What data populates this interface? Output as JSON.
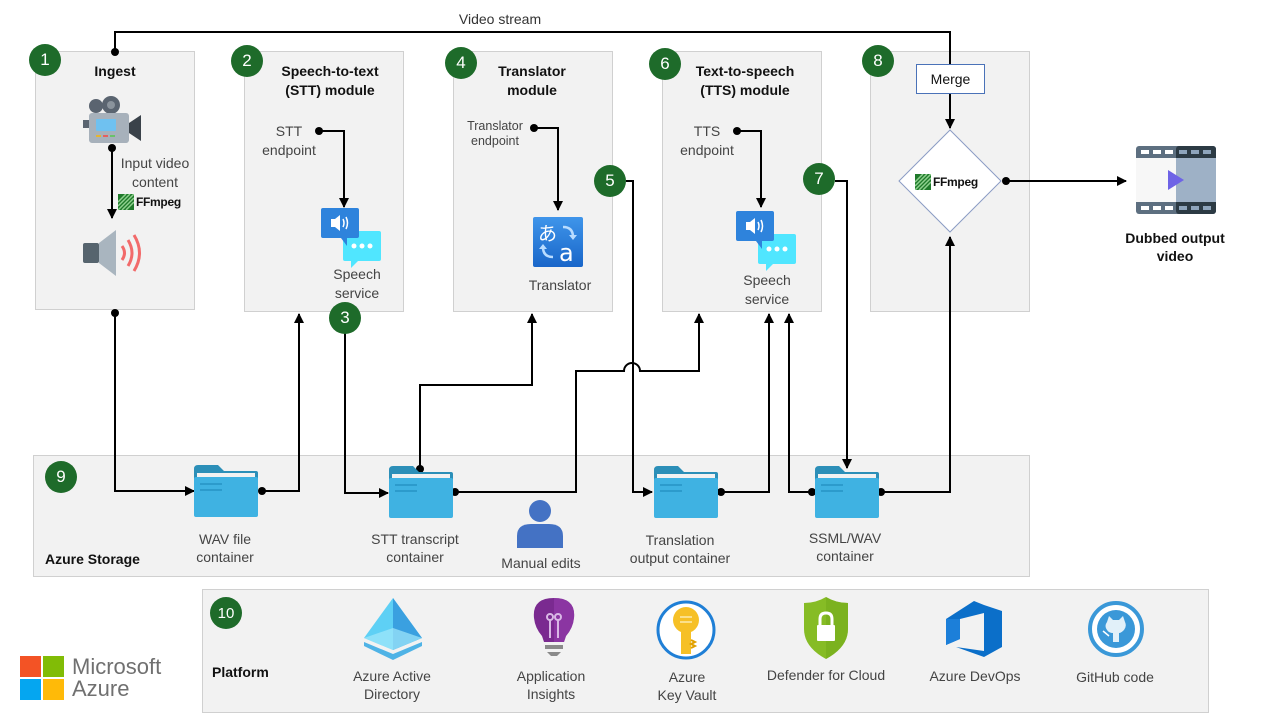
{
  "top_flow": {
    "video_stream_label": "Video stream"
  },
  "steps": {
    "ingest": {
      "badge": "1",
      "title": "Ingest",
      "input_label_line1": "Input video",
      "input_label_line2": "content",
      "ffmpeg_label": "FFmpeg"
    },
    "stt": {
      "badge": "2",
      "title_line1": "Speech-to-text",
      "title_line2": "(STT) module",
      "endpoint_line1": "STT",
      "endpoint_line2": "endpoint",
      "service_line1": "Speech",
      "service_line2": "service"
    },
    "stt_output": {
      "badge": "3"
    },
    "translator": {
      "badge": "4",
      "title_line1": "Translator",
      "title_line2": "module",
      "endpoint_line1": "Translator",
      "endpoint_line2": "endpoint",
      "service_label": "Translator"
    },
    "translation_output": {
      "badge": "5"
    },
    "tts": {
      "badge": "6",
      "title_line1": "Text-to-speech",
      "title_line2": "(TTS) module",
      "endpoint_line1": "TTS",
      "endpoint_line2": "endpoint",
      "service_line1": "Speech",
      "service_line2": "service"
    },
    "tts_output": {
      "badge": "7"
    },
    "merge": {
      "badge": "8",
      "merge_label": "Merge",
      "ffmpeg_label": "FFmpeg"
    }
  },
  "output": {
    "line1": "Dubbed output",
    "line2": "video"
  },
  "storage": {
    "badge": "9",
    "title": "Azure Storage",
    "containers": [
      {
        "line1": "WAV file",
        "line2": "container"
      },
      {
        "line1": "STT transcript",
        "line2": "container"
      },
      {
        "line1": "Translation",
        "line2": "output container"
      },
      {
        "line1": "SSML/WAV",
        "line2": "container"
      }
    ],
    "manual_edits_label": "Manual edits"
  },
  "platform": {
    "badge": "10",
    "title": "Platform",
    "items": [
      {
        "line1": "Azure Active",
        "line2": "Directory"
      },
      {
        "line1": "Application",
        "line2": "Insights"
      },
      {
        "line1": "Azure",
        "line2": "Key Vault"
      },
      {
        "line1": "Defender for Cloud",
        "line2": ""
      },
      {
        "line1": "Azure DevOps",
        "line2": ""
      },
      {
        "line1": "GitHub code",
        "line2": ""
      }
    ]
  },
  "brand": {
    "line1": "Microsoft",
    "line2": "Azure"
  },
  "colors": {
    "badge_green": "#1e6b2a",
    "panel_gray": "#f2f2f2",
    "folder_blue": "#3fb2e2",
    "merge_border": "#4a72b8"
  }
}
